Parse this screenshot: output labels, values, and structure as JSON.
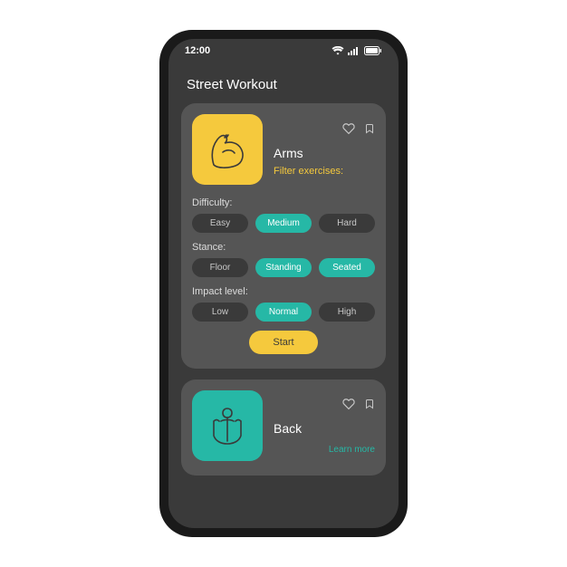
{
  "status": {
    "time": "12:00"
  },
  "app": {
    "title": "Street Workout"
  },
  "cards": {
    "arms": {
      "title": "Arms",
      "sub": "Filter exercises:",
      "start": "Start",
      "filters": {
        "difficulty": {
          "label": "Difficulty:",
          "opts": [
            "Easy",
            "Medium",
            "Hard"
          ],
          "active": [
            1
          ]
        },
        "stance": {
          "label": "Stance:",
          "opts": [
            "Floor",
            "Standing",
            "Seated"
          ],
          "active": [
            1,
            2
          ]
        },
        "impact": {
          "label": "Impact level:",
          "opts": [
            "Low",
            "Normal",
            "High"
          ],
          "active": [
            1
          ]
        }
      }
    },
    "back": {
      "title": "Back",
      "learn": "Learn more"
    }
  },
  "colors": {
    "accent_yellow": "#f5c93d",
    "accent_teal": "#26b8a6",
    "bg_dark": "#3a3a3a",
    "card": "#555555"
  }
}
